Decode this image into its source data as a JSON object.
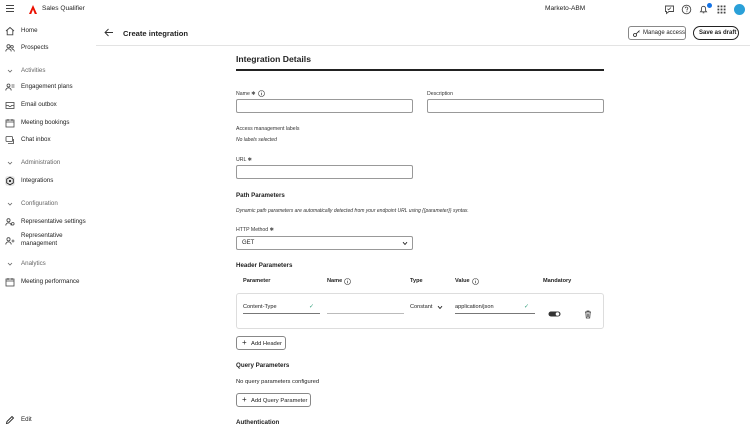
{
  "topbar": {
    "app_name": "Sales Qualifier",
    "workspace": "Marketo-ABM",
    "brand_color": "#eb1000",
    "accent": "#1473e6"
  },
  "sidebar": {
    "items": [
      {
        "label": "Home",
        "icon": "home-icon"
      },
      {
        "label": "Prospects",
        "icon": "people-icon"
      }
    ],
    "sections": [
      {
        "title": "Activities",
        "items": [
          {
            "label": "Engagement plans",
            "icon": "plan-icon"
          },
          {
            "label": "Email outbox",
            "icon": "outbox-icon"
          },
          {
            "label": "Meeting bookings",
            "icon": "calendar-icon"
          },
          {
            "label": "Chat inbox",
            "icon": "chat-icon"
          }
        ]
      },
      {
        "title": "Administration",
        "items": [
          {
            "label": "Integrations",
            "icon": "integrations-icon",
            "active": true
          }
        ]
      },
      {
        "title": "Configuration",
        "items": [
          {
            "label": "Representative settings",
            "icon": "rep-settings-icon"
          },
          {
            "label": "Representative management",
            "icon": "rep-management-icon"
          }
        ]
      },
      {
        "title": "Analytics",
        "items": [
          {
            "label": "Meeting performance",
            "icon": "performance-icon"
          }
        ]
      }
    ],
    "edit_label": "Edit"
  },
  "header": {
    "title": "Create integration",
    "manage_access": "Manage access",
    "save_draft": "Save as draft"
  },
  "form": {
    "section_title": "Integration Details",
    "name_label": "Name",
    "name_value": "",
    "description_label": "Description",
    "description_value": "",
    "access_labels_label": "Access management labels",
    "access_labels_value": "No labels selected",
    "url_label": "URL",
    "url_value": "",
    "path_params_title": "Path Parameters",
    "path_params_note": "Dynamic path parameters are automatically detected from your endpoint URL using {{parameter}} syntax.",
    "http_method_label": "HTTP Method",
    "http_method_value": "GET",
    "header_params_title": "Header Parameters",
    "header_columns": [
      "Parameter",
      "Name",
      "Type",
      "Value",
      "Mandatory"
    ],
    "header_rows": [
      {
        "parameter": "Content-Type",
        "name": "",
        "type": "Constant",
        "value": "application/json",
        "mandatory": true
      }
    ],
    "add_header": "Add Header",
    "query_params_title": "Query Parameters",
    "query_params_empty": "No query parameters configured",
    "add_query": "Add Query Parameter",
    "auth_title": "Authentication"
  }
}
